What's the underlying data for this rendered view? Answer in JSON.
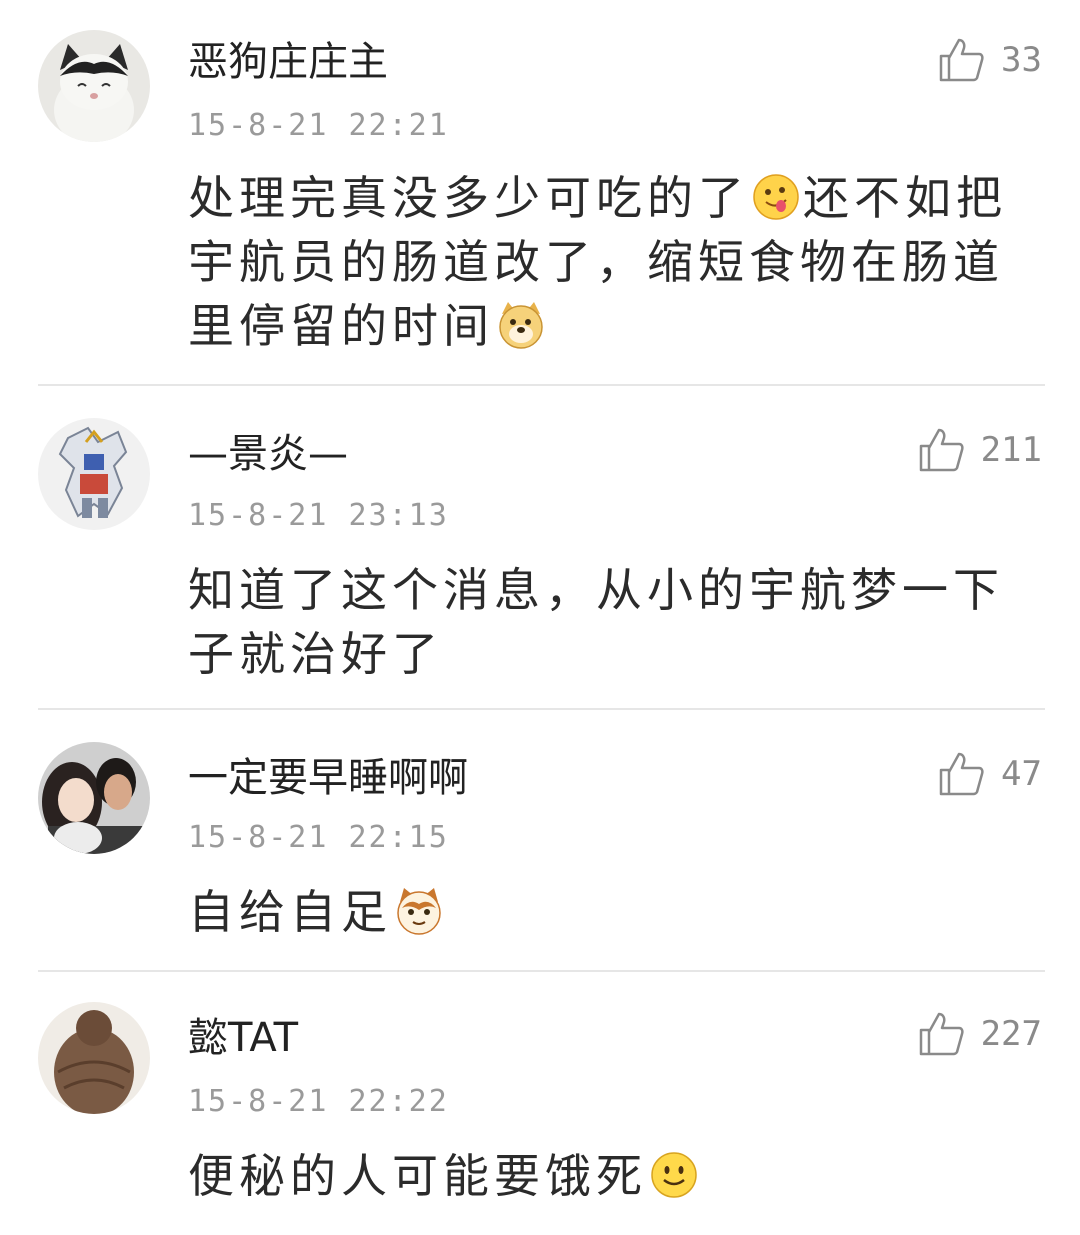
{
  "comments": [
    {
      "username": "恶狗庄庄主",
      "likes": "33",
      "timestamp": "15-8-21 22:21",
      "text_a": "处理完真没多少可吃的了",
      "emoji_a": "tongue-out-emoji",
      "text_b": "还不如把宇航员的肠道改了，缩短食物在肠道里停留的时间",
      "emoji_b": "doge-emoji",
      "avatar": "cat-avatar"
    },
    {
      "username": "—景炎—",
      "likes": "211",
      "timestamp": "15-8-21 23:13",
      "text_a": "知道了这个消息，从小的宇航梦一下子就治好了",
      "avatar": "robot-avatar"
    },
    {
      "username": "一定要早睡啊啊",
      "likes": "47",
      "timestamp": "15-8-21 22:15",
      "text_a": "自给自足",
      "emoji_a": "cat-face-emoji",
      "avatar": "couple-avatar"
    },
    {
      "username": "懿TAT",
      "likes": "227",
      "timestamp": "15-8-21 22:22",
      "text_a": "便秘的人可能要饿死",
      "emoji_a": "smile-emoji",
      "avatar": "hair-bun-avatar"
    }
  ],
  "colors": {
    "divider": "#e6e6e6",
    "meta": "#9a9a9a",
    "text": "#2b2b2b"
  }
}
